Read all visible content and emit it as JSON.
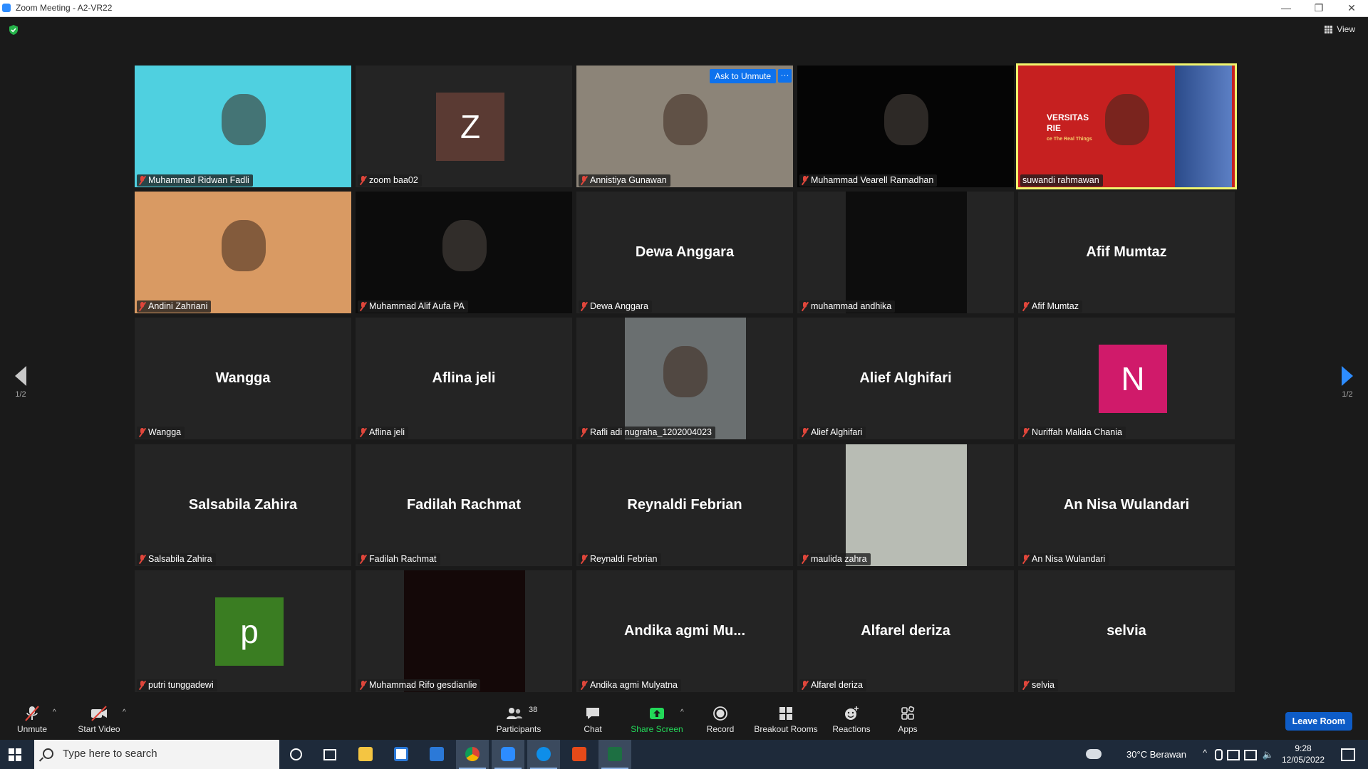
{
  "window": {
    "title": "Zoom Meeting - A2-VR22"
  },
  "header": {
    "view_label": "View"
  },
  "tiles": [
    {
      "name": "Muhammad Ridwan Fadli",
      "kind": "video",
      "bg": "#4fd0e0"
    },
    {
      "name": "zoom baa02",
      "kind": "avatar",
      "letter": "Z",
      "color": "#5a3a33"
    },
    {
      "name": "Annistiya Gunawan",
      "kind": "video",
      "bg": "#8c8478",
      "ask_unmute": "Ask to Unmute",
      "more": "···"
    },
    {
      "name": "Muhammad Vearell Ramadhan",
      "kind": "video",
      "bg": "#050505"
    },
    {
      "name": "suwandi rahmawan",
      "kind": "video",
      "bg": "#c62020",
      "active": true,
      "banner_line1": "VERSITAS",
      "banner_line2": "RIE",
      "banner_line3": "ce The Real Things"
    },
    {
      "name": "Andini Zahriani",
      "kind": "video",
      "bg": "#d99a63"
    },
    {
      "name": "Muhammad Alif Aufa PA",
      "kind": "video",
      "bg": "#0c0c0c"
    },
    {
      "name": "Dewa Anggara",
      "kind": "name",
      "display": "Dewa Anggara"
    },
    {
      "name": "muhammad andhika",
      "kind": "video",
      "bg": "#0d0d0d",
      "narrow": true
    },
    {
      "name": "Afif Mumtaz",
      "kind": "name",
      "display": "Afif Mumtaz"
    },
    {
      "name": "Wangga",
      "kind": "name",
      "display": "Wangga"
    },
    {
      "name": "Aflina jeli",
      "kind": "name",
      "display": "Aflina jeli"
    },
    {
      "name": "Rafli adi nugraha_1202004023",
      "kind": "video",
      "bg": "#6a6f70",
      "narrow": true
    },
    {
      "name": "Alief Alghifari",
      "kind": "name",
      "display": "Alief Alghifari"
    },
    {
      "name": "Nuriffah Malida Chania",
      "kind": "avatar",
      "letter": "N",
      "color": "#d01a6a"
    },
    {
      "name": "Salsabila Zahira",
      "kind": "name",
      "display": "Salsabila Zahira"
    },
    {
      "name": "Fadilah Rachmat",
      "kind": "name",
      "display": "Fadilah Rachmat"
    },
    {
      "name": "Reynaldi Febrian",
      "kind": "name",
      "display": "Reynaldi Febrian"
    },
    {
      "name": "maulida zahra",
      "kind": "video",
      "bg": "#b8bcb4",
      "narrow": true
    },
    {
      "name": "An Nisa Wulandari",
      "kind": "name",
      "display": "An Nisa Wulandari"
    },
    {
      "name": "putri tunggadewi",
      "kind": "avatar",
      "letter": "p",
      "color": "#3a7d22"
    },
    {
      "name": "Muhammad Rifo gesdianlie",
      "kind": "video",
      "bg": "#140808",
      "narrow": true
    },
    {
      "name": "Andika agmi Mulyatna",
      "kind": "name",
      "display": "Andika  agmi  Mu..."
    },
    {
      "name": "Alfarel deriza",
      "kind": "name",
      "display": "Alfarel deriza"
    },
    {
      "name": "selvia",
      "kind": "name",
      "display": "selvia"
    }
  ],
  "pager": {
    "left": "1/2",
    "right": "1/2"
  },
  "toolbar": {
    "unmute": "Unmute",
    "start_video": "Start Video",
    "participants": "Participants",
    "participants_count": "38",
    "chat": "Chat",
    "share_screen": "Share Screen",
    "record": "Record",
    "breakout_rooms": "Breakout Rooms",
    "reactions": "Reactions",
    "apps": "Apps",
    "leave_room": "Leave Room"
  },
  "taskbar": {
    "search_placeholder": "Type here to search",
    "weather": "30°C  Berawan",
    "time": "9:28",
    "date": "12/05/2022"
  },
  "colors": {
    "accent": "#0e72ed",
    "active_speaker": "#f1f56e",
    "muted": "#e0463b",
    "share_green": "#23d959"
  }
}
